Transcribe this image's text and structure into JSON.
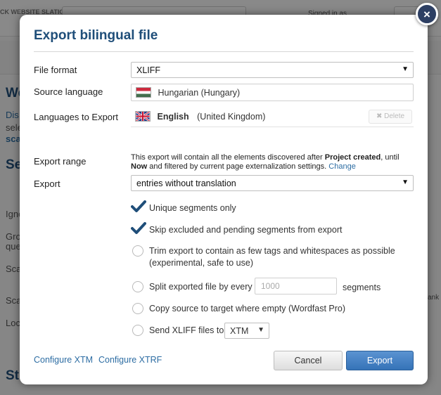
{
  "background": {
    "logo_text": "CK WEBSITE SLATIO",
    "signed_in": "Signed in as",
    "left_fragments": [
      "We",
      "Dis",
      "sele",
      "sca",
      "Se",
      "Igne",
      "Gro",
      "que",
      "Sca",
      "Sca",
      "Loc",
      "St"
    ],
    "right_fragment": "ank"
  },
  "dialog": {
    "title": "Export bilingual file",
    "file_format": {
      "label": "File format",
      "value": "XLIFF"
    },
    "source_language": {
      "label": "Source language",
      "value": "Hungarian (Hungary)",
      "flag": "hungary-flag"
    },
    "languages_to_export": {
      "label": "Languages to Export",
      "language_name": "English",
      "language_region": "(United Kingdom)",
      "flag": "uk-flag",
      "delete_label": "Delete"
    },
    "export_range": {
      "label": "Export range",
      "text_1": "This export will contain all the elements discovered after",
      "bold_1": "Project created",
      "text_2": ", until",
      "bold_2": "Now",
      "text_3": "and filtered by current page externalization settings.",
      "change_link": "Change"
    },
    "export": {
      "label": "Export",
      "value": "entries without translation"
    },
    "options": {
      "unique_segments": {
        "label": "Unique segments only",
        "checked": true
      },
      "skip_excluded": {
        "label": "Skip excluded and pending segments from export",
        "checked": true
      },
      "trim_export": {
        "label_line1": "Trim export to contain as few tags and whitespaces as possible",
        "label_line2": "(experimental, safe to use)",
        "checked": false
      },
      "split_file": {
        "label": "Split exported file by every",
        "placeholder": "1000",
        "suffix": "segments",
        "checked": false
      },
      "copy_source": {
        "label": "Copy source to target where empty (Wordfast Pro)",
        "checked": false
      },
      "send_xliff": {
        "label": "Send XLIFF files to",
        "value": "XTM",
        "checked": false
      }
    },
    "footer": {
      "configure_xtm": "Configure XTM",
      "configure_xtrf": "Configure XTRF",
      "cancel": "Cancel",
      "export": "Export"
    },
    "close": "×"
  }
}
